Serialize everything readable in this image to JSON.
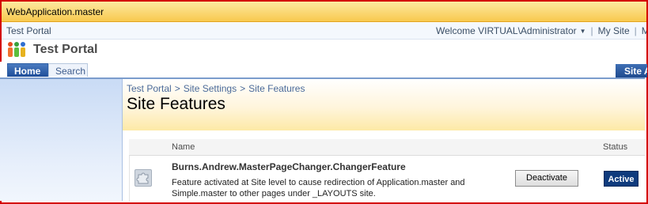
{
  "window": {
    "title": "WebApplication.master"
  },
  "topbar": {
    "site_name": "Test Portal",
    "welcome": "Welcome VIRTUAL\\Administrator",
    "links": [
      "My Site",
      "My Lin"
    ]
  },
  "header": {
    "title": "Test Portal"
  },
  "tabs": [
    {
      "label": "Home",
      "active": true
    },
    {
      "label": "Search",
      "active": false
    }
  ],
  "site_actions_label": "Site A",
  "breadcrumb": [
    "Test Portal",
    "Site Settings",
    "Site Features"
  ],
  "breadcrumb_separator": ">",
  "page": {
    "title": "Site Features"
  },
  "table": {
    "columns": [
      "Name",
      "Status"
    ],
    "rows": [
      {
        "name": "Burns.Andrew.MasterPageChanger.ChangerFeature",
        "description": "Feature activated at Site level to cause redirection of Application.master and Simple.master to other pages under _LAYOUTS site.",
        "action": "Deactivate",
        "status": "Active"
      }
    ]
  },
  "colors": {
    "accent": "#1f4e99",
    "status_active": "#0f3b7d",
    "frame_border": "#d40000"
  },
  "icons": {
    "logo": "people-logo-icon",
    "feature": "puzzle-feature-icon",
    "dropdown": "chevron-down-icon"
  }
}
